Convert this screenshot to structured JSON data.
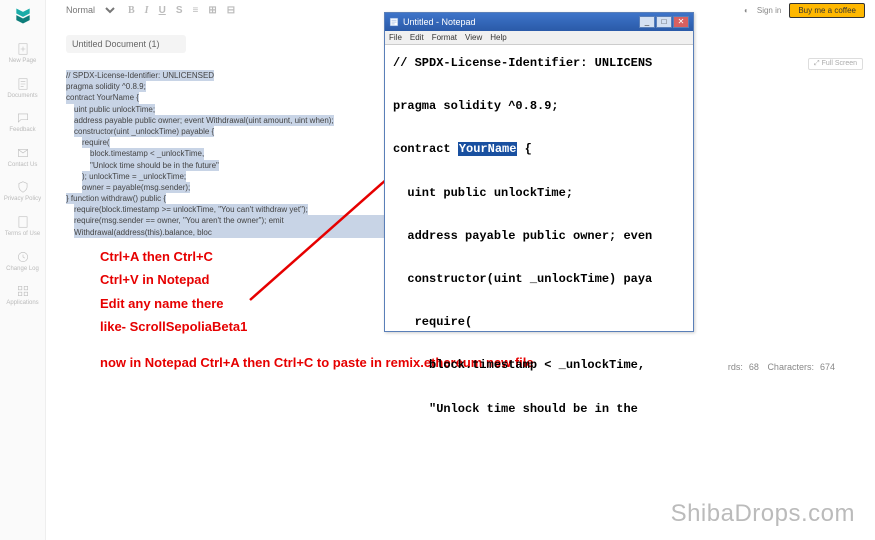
{
  "sidebar": {
    "items": [
      {
        "label": "New Page"
      },
      {
        "label": "Documents"
      },
      {
        "label": "Feedback"
      },
      {
        "label": "Contact Us"
      },
      {
        "label": "Privacy Policy"
      },
      {
        "label": "Terms of Use"
      },
      {
        "label": "Change Log"
      },
      {
        "label": "Applications"
      }
    ]
  },
  "topbar": {
    "style": "Normal",
    "tools": [
      "B",
      "I",
      "U",
      "S",
      "≡",
      "⊞",
      "⊟"
    ],
    "signin": "Sign in",
    "buy": "Buy me a coffee"
  },
  "doc": {
    "title": "Untitled Document (1)"
  },
  "fullscreen": "Full Screen",
  "code": {
    "lines": [
      "// SPDX-License-Identifier: UNLICENSED",
      "pragma solidity ^0.8.9;",
      "contract YourName {",
      "uint public unlockTime;",
      "address payable public owner; event Withdrawal(uint amount, uint when);",
      "constructor(uint _unlockTime) payable {",
      "require(",
      "block.timestamp < _unlockTime,",
      "\"Unlock time should be in the future\"",
      "); unlockTime = _unlockTime;",
      "owner = payable(msg.sender);",
      "} function withdraw() public {",
      "require(block.timestamp >= unlockTime, \"You can't withdraw yet\");",
      "require(msg.sender == owner, \"You aren't the owner\"); emit Withdrawal(address(this).balance, bloc"
    ]
  },
  "instructions": {
    "l1": "Ctrl+A  then Ctrl+C",
    "l2": "Ctrl+V in Notepad",
    "l3": "Edit any name there",
    "l4": "like- ScrollSepoliaBeta1",
    "bottom": "now in Notepad Ctrl+A then Ctrl+C to paste in remix.ethereum new file"
  },
  "notepad": {
    "title": "Untitled - Notepad",
    "menu": [
      "File",
      "Edit",
      "Format",
      "View",
      "Help"
    ],
    "body_pre": "// SPDX-License-Identifier: UNLICENS\n\npragma solidity ^0.8.9;\n\ncontract ",
    "highlight": "YourName",
    "body_post": " {\n\n  uint public unlockTime;\n\n  address payable public owner; even\n\n  constructor(uint _unlockTime) paya\n\n   require(\n\n     block.timestamp < _unlockTime,\n\n     \"Unlock time should be in the"
  },
  "status": {
    "words_label": "rds:",
    "words": "68",
    "chars_label": "Characters:",
    "chars": "674"
  },
  "watermark": "ShibaDrops.com"
}
